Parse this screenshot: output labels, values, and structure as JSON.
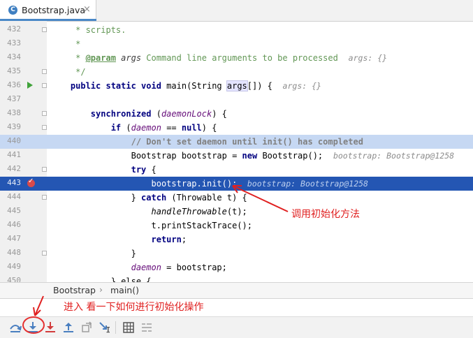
{
  "tab": {
    "filename": "Bootstrap.java",
    "icon_letter": "C",
    "close_glyph": "×"
  },
  "lines": [
    {
      "num": "432",
      "segs": [
        {
          "t": "     * ",
          "c": "#629755",
          "i": true
        },
        {
          "t": "scripts.",
          "c": "#629755",
          "i": false,
          "b": false
        }
      ]
    },
    {
      "num": "433",
      "segs": [
        {
          "t": "     *",
          "c": "#629755"
        }
      ]
    },
    {
      "num": "434",
      "segs": [
        {
          "t": "     * ",
          "c": "#629755"
        },
        {
          "t": "@param",
          "c": "#629755",
          "b": true,
          "u": true
        },
        {
          "t": " ",
          "c": "#629755"
        },
        {
          "t": "args",
          "c": "#3d3d3d",
          "i": true
        },
        {
          "t": " Command line arguments to be processed",
          "c": "#629755"
        }
      ],
      "hint": "args: {}"
    },
    {
      "num": "435",
      "segs": [
        {
          "t": "     */",
          "c": "#629755"
        }
      ]
    },
    {
      "num": "436",
      "segs": [
        {
          "t": "    public static void ",
          "c": "#000080",
          "b": true
        },
        {
          "t": "main(String ",
          "c": "#000000"
        },
        {
          "t": "args",
          "c": "#000000",
          "hlbox": true
        },
        {
          "t": "[]) {",
          "c": "#000000"
        }
      ],
      "hint": "args: {}"
    },
    {
      "num": "437",
      "segs": []
    },
    {
      "num": "438",
      "segs": [
        {
          "t": "        synchronized ",
          "c": "#000080",
          "b": true
        },
        {
          "t": "(",
          "c": "#000000"
        },
        {
          "t": "daemonLock",
          "c": "#660e7a",
          "i": true
        },
        {
          "t": ") {",
          "c": "#000000"
        }
      ]
    },
    {
      "num": "439",
      "segs": [
        {
          "t": "            if ",
          "c": "#000080",
          "b": true
        },
        {
          "t": "(",
          "c": "#000000"
        },
        {
          "t": "daemon",
          "c": "#660e7a",
          "i": true
        },
        {
          "t": " == ",
          "c": "#000000"
        },
        {
          "t": "null",
          "c": "#000080",
          "b": true
        },
        {
          "t": ") {",
          "c": "#000000"
        }
      ]
    },
    {
      "num": "440",
      "segs": [
        {
          "t": "                // Don't set daemon until init() has completed",
          "c": "#808080",
          "b": true
        }
      ]
    },
    {
      "num": "441",
      "segs": [
        {
          "t": "                Bootstrap bootstrap = ",
          "c": "#000000"
        },
        {
          "t": "new ",
          "c": "#000080",
          "b": true
        },
        {
          "t": "Bootstrap();",
          "c": "#000000"
        }
      ],
      "hint": "bootstrap: Bootstrap@1258"
    },
    {
      "num": "442",
      "segs": [
        {
          "t": "                try ",
          "c": "#000080",
          "b": true
        },
        {
          "t": "{",
          "c": "#000000"
        }
      ]
    },
    {
      "num": "443",
      "segs": [
        {
          "t": "                    bootstrap.init();",
          "c": "#ffffff"
        }
      ],
      "hint": "bootstrap: Bootstrap@1258"
    },
    {
      "num": "444",
      "segs": [
        {
          "t": "                } ",
          "c": "#000000"
        },
        {
          "t": "catch ",
          "c": "#000080",
          "b": true
        },
        {
          "t": "(Throwable t) {",
          "c": "#000000"
        }
      ]
    },
    {
      "num": "445",
      "segs": [
        {
          "t": "                    ",
          "c": "#000000"
        },
        {
          "t": "handleThrowable",
          "c": "#000000",
          "i": true
        },
        {
          "t": "(t);",
          "c": "#000000"
        }
      ]
    },
    {
      "num": "446",
      "segs": [
        {
          "t": "                    t.printStackTrace();",
          "c": "#000000"
        }
      ]
    },
    {
      "num": "447",
      "segs": [
        {
          "t": "                    return",
          "c": "#000080",
          "b": true
        },
        {
          "t": ";",
          "c": "#000000"
        }
      ]
    },
    {
      "num": "448",
      "segs": [
        {
          "t": "                }",
          "c": "#000000"
        }
      ]
    },
    {
      "num": "449",
      "segs": [
        {
          "t": "                ",
          "c": "#000000"
        },
        {
          "t": "daemon",
          "c": "#660e7a",
          "i": true
        },
        {
          "t": " = bootstrap;",
          "c": "#000000"
        }
      ]
    },
    {
      "num": "450",
      "segs": [
        {
          "t": "            } else {",
          "c": "#000000"
        }
      ]
    }
  ],
  "breadcrumb": {
    "class_name": "Bootstrap",
    "separator": "›",
    "method_name": "main()"
  },
  "annotations": {
    "init_method": "调用初始化方法",
    "step_into": "进入 看一下如何进行初始化操作"
  },
  "toolbar": {
    "buttons": [
      {
        "name": "step-over-icon",
        "color": "#4a7fc0"
      },
      {
        "name": "step-into-icon",
        "color": "#4a7fc0"
      },
      {
        "name": "force-step-into-icon",
        "color": "#d23c3c"
      },
      {
        "name": "step-out-icon",
        "color": "#4a7fc0"
      },
      {
        "name": "drop-frame-icon",
        "color": "#9e9e9e"
      },
      {
        "name": "run-to-cursor-icon",
        "color": "#4a7fc0"
      },
      {
        "name": "evaluate-expression-icon",
        "color": "#555555"
      },
      {
        "name": "trace-current-stream-icon",
        "color": "#9e9e9e"
      }
    ]
  },
  "colors": {
    "exec_line": "#2456b3",
    "highlight_line": "#c6d8f3",
    "annotation": "#e02020"
  }
}
